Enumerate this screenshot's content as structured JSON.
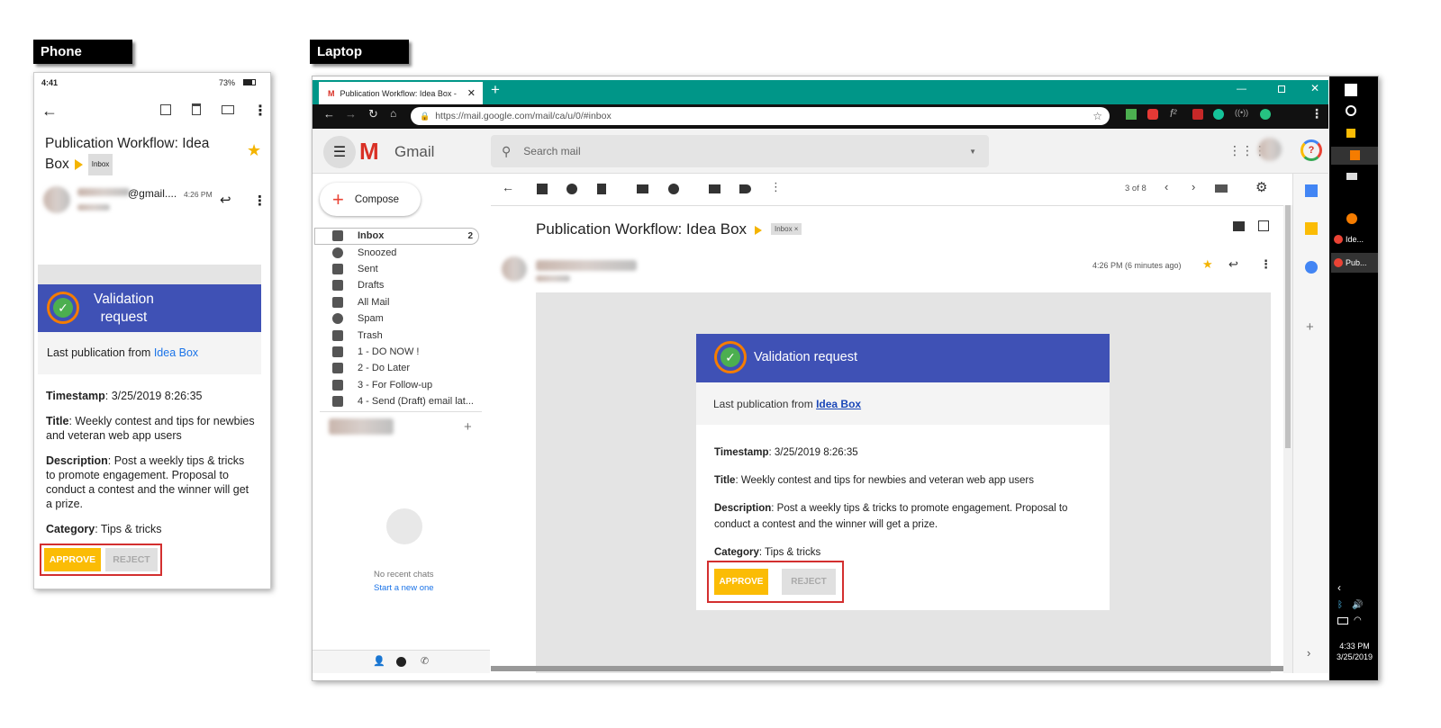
{
  "labels": {
    "phone": "Phone",
    "laptop": "Laptop"
  },
  "phone": {
    "time": "4:41",
    "battery": "73%",
    "subject_line1": "Publication Workflow: Idea",
    "subject_line2": "Box",
    "inbox_chip": "Inbox",
    "sender_suffix": "@gmail....",
    "time_sent": "4:26 PM"
  },
  "card": {
    "title": "Validation request",
    "title_line1": "Validation",
    "title_line2": "request",
    "last_pub_prefix": "Last publication from",
    "last_pub_link": "Idea Box",
    "timestamp_label": "Timestamp",
    "timestamp_value": ": 3/25/2019 8:26:35",
    "title_label": "Title",
    "title_value": ": Weekly contest and tips for newbies and veteran web app users",
    "description_label": "Description",
    "description_value": ": Post a weekly tips & tricks to promote engagement. Proposal to conduct a contest and the winner will get a prize.",
    "category_label": "Category",
    "category_value": ": Tips & tricks",
    "approve": "APPROVE",
    "reject": "REJECT"
  },
  "browser": {
    "tab_title": "Publication Workflow: Idea Box -",
    "new_tab": "+",
    "url": "https://mail.google.com/mail/ca/u/0/#inbox"
  },
  "gmail": {
    "brand": "Gmail",
    "search_placeholder": "Search mail",
    "compose": "Compose",
    "pager": "3 of 8",
    "subject": "Publication Workflow: Idea Box",
    "inbox_chip": "Inbox ×",
    "received": "4:26 PM (6 minutes ago)",
    "no_chats": "No recent chats",
    "start_chat": "Start a new one",
    "nav": [
      {
        "label": "Inbox",
        "count": "2"
      },
      {
        "label": "Snoozed"
      },
      {
        "label": "Sent"
      },
      {
        "label": "Drafts"
      },
      {
        "label": "All Mail"
      },
      {
        "label": "Spam"
      },
      {
        "label": "Trash"
      },
      {
        "label": "1 - DO NOW !"
      },
      {
        "label": "2 - Do Later"
      },
      {
        "label": "3 - For Follow-up"
      },
      {
        "label": "4 - Send (Draft) email lat..."
      }
    ]
  },
  "taskbar": {
    "item1": "Ide...",
    "item2": "Pub...",
    "clock_time": "4:33 PM",
    "clock_date": "3/25/2019"
  },
  "colors": {
    "banner": "#3f51b5",
    "approve": "#fbbc05",
    "tabbar": "#009688",
    "gmail_red": "#d93025"
  }
}
